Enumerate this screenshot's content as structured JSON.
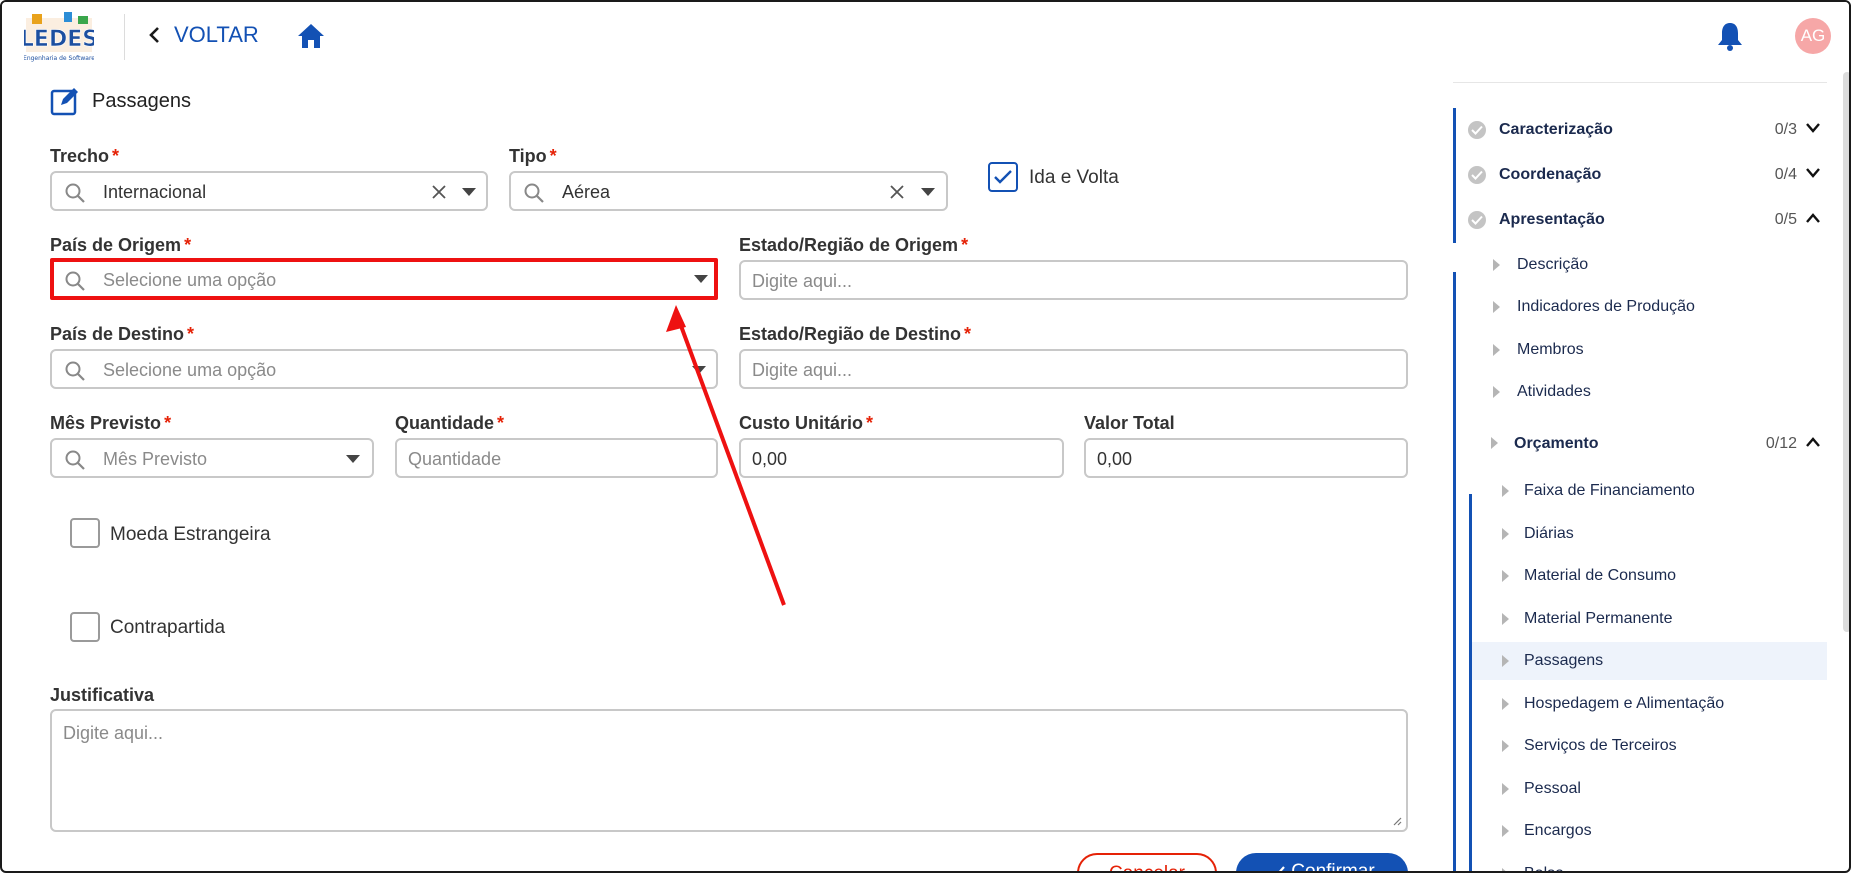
{
  "header": {
    "logo_text": "LEDES",
    "logo_subtitle": "Engenharia de Software",
    "back_label": "VOLTAR",
    "avatar_initials": "AG"
  },
  "form": {
    "section_title": "Passagens",
    "trecho": {
      "label": "Trecho",
      "value": "Internacional"
    },
    "tipo": {
      "label": "Tipo",
      "value": "Aérea"
    },
    "ida_volta": {
      "label": "Ida e Volta",
      "checked": true
    },
    "pais_origem": {
      "label": "País de Origem",
      "placeholder": "Selecione uma opção"
    },
    "estado_origem": {
      "label": "Estado/Região de Origem",
      "placeholder": "Digite aqui..."
    },
    "pais_destino": {
      "label": "País de Destino",
      "placeholder": "Selecione uma opção"
    },
    "estado_destino": {
      "label": "Estado/Região de Destino",
      "placeholder": "Digite aqui..."
    },
    "mes_previsto": {
      "label": "Mês Previsto",
      "placeholder": "Mês Previsto"
    },
    "quantidade": {
      "label": "Quantidade",
      "placeholder": "Quantidade"
    },
    "custo_unitario": {
      "label": "Custo Unitário",
      "value": "0,00"
    },
    "valor_total": {
      "label": "Valor Total",
      "value": "0,00"
    },
    "moeda_estrangeira": {
      "label": "Moeda Estrangeira",
      "checked": false
    },
    "contrapartida": {
      "label": "Contrapartida",
      "checked": false
    },
    "justificativa": {
      "label": "Justificativa",
      "placeholder": "Digite aqui..."
    },
    "required_mark": "*",
    "cancel_label": "Cancelar",
    "confirm_label": "Confirmar"
  },
  "sidebar": {
    "groups": [
      {
        "label": "Caracterização",
        "count": "0/3",
        "expanded": false
      },
      {
        "label": "Coordenação",
        "count": "0/4",
        "expanded": false
      },
      {
        "label": "Apresentação",
        "count": "0/5",
        "expanded": true
      }
    ],
    "apresentacao_items": [
      "Descrição",
      "Indicadores de Produção",
      "Membros",
      "Atividades"
    ],
    "orcamento": {
      "label": "Orçamento",
      "count": "0/12",
      "expanded": true
    },
    "orcamento_items": [
      "Faixa de Financiamento",
      "Diárias",
      "Material de Consumo",
      "Material Permanente",
      "Passagens",
      "Hospedagem e Alimentação",
      "Serviços de Terceiros",
      "Pessoal",
      "Encargos",
      "Bolsa"
    ],
    "active_item": "Passagens"
  },
  "annotation": {
    "color": "#ee1111",
    "target": "pais-origem-select"
  },
  "colors": {
    "primary": "#1351b4",
    "danger": "#e52207",
    "avatar_bg": "#f6a7a7"
  }
}
